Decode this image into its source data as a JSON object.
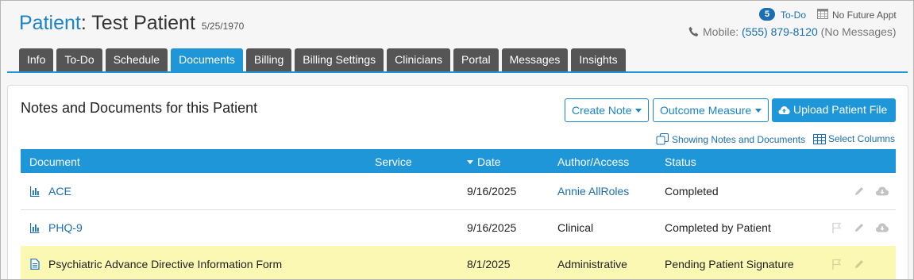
{
  "header": {
    "patient_word": "Patient",
    "patient_rest": ": Test Patient",
    "dob": "5/25/1970",
    "todo_count": "5",
    "todo_label": "To-Do",
    "no_future_appt": "No Future Appt",
    "mobile_label": "Mobile:",
    "mobile_number": "(555) 879-8120",
    "mobile_messages": "(No Messages)"
  },
  "tabs": [
    {
      "label": "Info",
      "active": false
    },
    {
      "label": "To-Do",
      "active": false
    },
    {
      "label": "Schedule",
      "active": false
    },
    {
      "label": "Documents",
      "active": true
    },
    {
      "label": "Billing",
      "active": false
    },
    {
      "label": "Billing Settings",
      "active": false
    },
    {
      "label": "Clinicians",
      "active": false
    },
    {
      "label": "Portal",
      "active": false
    },
    {
      "label": "Messages",
      "active": false
    },
    {
      "label": "Insights",
      "active": false
    }
  ],
  "panel": {
    "title": "Notes and Documents for this Patient",
    "create_note": "Create Note",
    "outcome_measure": "Outcome Measure",
    "upload": "Upload Patient File",
    "showing": "Showing Notes and Documents",
    "select_columns": "Select Columns"
  },
  "table": {
    "columns": {
      "document": "Document",
      "service": "Service",
      "date": "Date",
      "author": "Author/Access",
      "status": "Status"
    },
    "rows": [
      {
        "icon": "chart-icon",
        "document": "ACE",
        "service": "",
        "date": "9/16/2025",
        "author": "Annie AllRoles",
        "status": "Completed"
      },
      {
        "icon": "chart-icon",
        "document": "PHQ-9",
        "service": "",
        "date": "9/16/2025",
        "author": "Clinical",
        "status": "Completed by Patient"
      },
      {
        "icon": "document-icon",
        "document": "Psychiatric Advance Directive Information Form",
        "service": "",
        "date": "8/1/2025",
        "author": "Administrative",
        "status": "Pending Patient Signature"
      }
    ]
  },
  "colors": {
    "accent": "#1e96d8",
    "link": "#1a6fb3",
    "tab_inactive": "#555555",
    "highlight_row": "#fbf8b4",
    "action_icon": "#bdbdbd"
  }
}
